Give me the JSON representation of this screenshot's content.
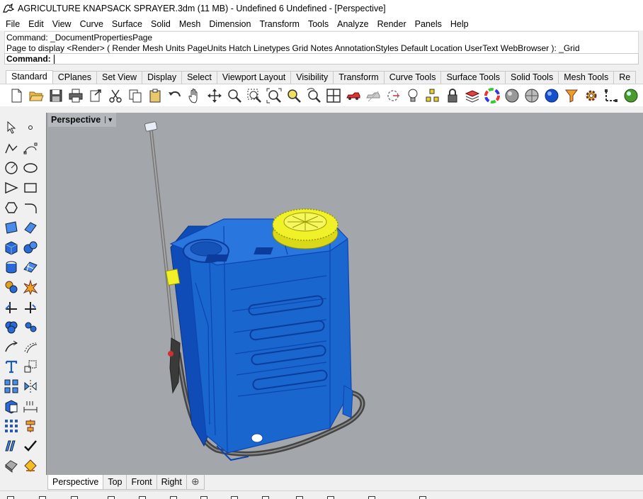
{
  "window": {
    "title": "AGRICULTURE KNAPSACK SPRAYER.3dm (11 MB) - Undefined 6 Undefined - [Perspective]"
  },
  "menu": [
    "File",
    "Edit",
    "View",
    "Curve",
    "Surface",
    "Solid",
    "Mesh",
    "Dimension",
    "Transform",
    "Tools",
    "Analyze",
    "Render",
    "Panels",
    "Help"
  ],
  "command": {
    "history": [
      "Command: _DocumentPropertiesPage",
      "Page to display <Render> ( Render  Mesh  Units  PageUnits  Hatch  Linetypes  Grid  Notes  AnnotationStyles  Default  Location  UserText  WebBrowser ): _Grid"
    ],
    "prompt_label": "Command:",
    "input_value": ""
  },
  "toolbar_tabs": [
    "Standard",
    "CPlanes",
    "Set View",
    "Display",
    "Select",
    "Viewport Layout",
    "Visibility",
    "Transform",
    "Curve Tools",
    "Surface Tools",
    "Solid Tools",
    "Mesh Tools",
    "Re"
  ],
  "active_toolbar_tab": 0,
  "toolbar_icons": [
    "new-icon",
    "open-icon",
    "save-icon",
    "print-icon",
    "import-icon",
    "cut-icon",
    "copy-icon",
    "paste-icon",
    "undo-icon",
    "pan-icon",
    "rotate-view-icon",
    "zoom-icon",
    "zoom-window-icon",
    "zoom-extents-icon",
    "zoom-selected-icon",
    "rotate-icon",
    "four-viewports-icon",
    "car-icon",
    "ghosted-icon",
    "cplane-icon",
    "light-icon",
    "points-icon",
    "lock-icon",
    "layer-icon",
    "color-wheel-icon",
    "shaded-sphere-icon",
    "ghosted-sphere-icon",
    "rendered-sphere-icon",
    "select-filter-icon",
    "options-gear-icon",
    "gumball-icon",
    "rendered-ball-icon"
  ],
  "sidebar_icons": [
    "select-arrow-icon",
    "point-icon",
    "polyline-icon",
    "curve-cv-icon",
    "circle-icon",
    "ellipse-icon",
    "arc-icon",
    "rectangle-icon",
    "polygon-icon",
    "fillet-curve-icon",
    "surface-from-points-icon",
    "extrude-surface-icon",
    "box-icon",
    "sphere-icon",
    "cylinder-icon",
    "mesh-plane-icon",
    "boolean-icon",
    "explode-icon",
    "trim-icon",
    "split-icon",
    "boolean-union-icon",
    "points-on-icon",
    "fillet-icon",
    "offset-icon",
    "text-icon",
    "scale-icon",
    "group-icon",
    "mirror-icon",
    "box-edit-icon",
    "dimension-icon",
    "array-icon",
    "align-icon",
    "section-icon",
    "check-icon",
    "analyze-icon",
    "render-icon"
  ],
  "viewport": {
    "title": "Perspective",
    "dropdown": "▼",
    "background": "#a3a6ab"
  },
  "colors": {
    "body_blue": "#1a66cf",
    "wire_blue": "#0d44b0",
    "cap_yellow": "#f1f12a",
    "lance_gray": "#7a7a7a"
  },
  "view_tabs": [
    "Perspective",
    "Top",
    "Front",
    "Right"
  ],
  "add_tab": "⊕"
}
